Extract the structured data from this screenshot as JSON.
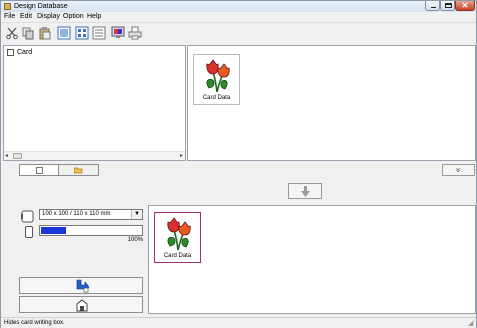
{
  "window": {
    "title": "Design Database"
  },
  "menu": [
    "File",
    "Edit",
    "Display",
    "Option",
    "Help"
  ],
  "toolbar": {
    "icons": [
      "cut-icon",
      "copy-icon",
      "paste-icon",
      "thumbnail-view-icon",
      "grid-view-icon",
      "list-view-icon",
      "monitor-icon",
      "print-icon"
    ]
  },
  "tree": {
    "root_label": "Card",
    "root_checked": false
  },
  "preview_card": {
    "caption": "Card Data"
  },
  "tabs": [
    {
      "icon": "card-icon",
      "active": true
    },
    {
      "icon": "folder-open-icon",
      "active": false
    }
  ],
  "expand_button": {
    "glyph": "»",
    "icon": "double-chevron-down-icon"
  },
  "transfer_button": {
    "icon": "arrow-down-icon"
  },
  "card_size": {
    "selected": "100 x 100 / 110 x 110 mm",
    "icon": "card-size-icon"
  },
  "memory": {
    "percent_label": "100%",
    "fill_fraction": 0.25,
    "fill_color": "#1a35d6"
  },
  "actions": {
    "write_card_icon": "write-to-card-icon",
    "card_slot_icon": "card-slot-icon"
  },
  "card_list": [
    {
      "caption": "Card Data",
      "selected": true
    }
  ],
  "status": {
    "text": "Hides card writing box."
  },
  "colors": {
    "selection_border": "#a0307a",
    "progress_blue": "#1a35d6",
    "close_red": "#c7432c"
  }
}
